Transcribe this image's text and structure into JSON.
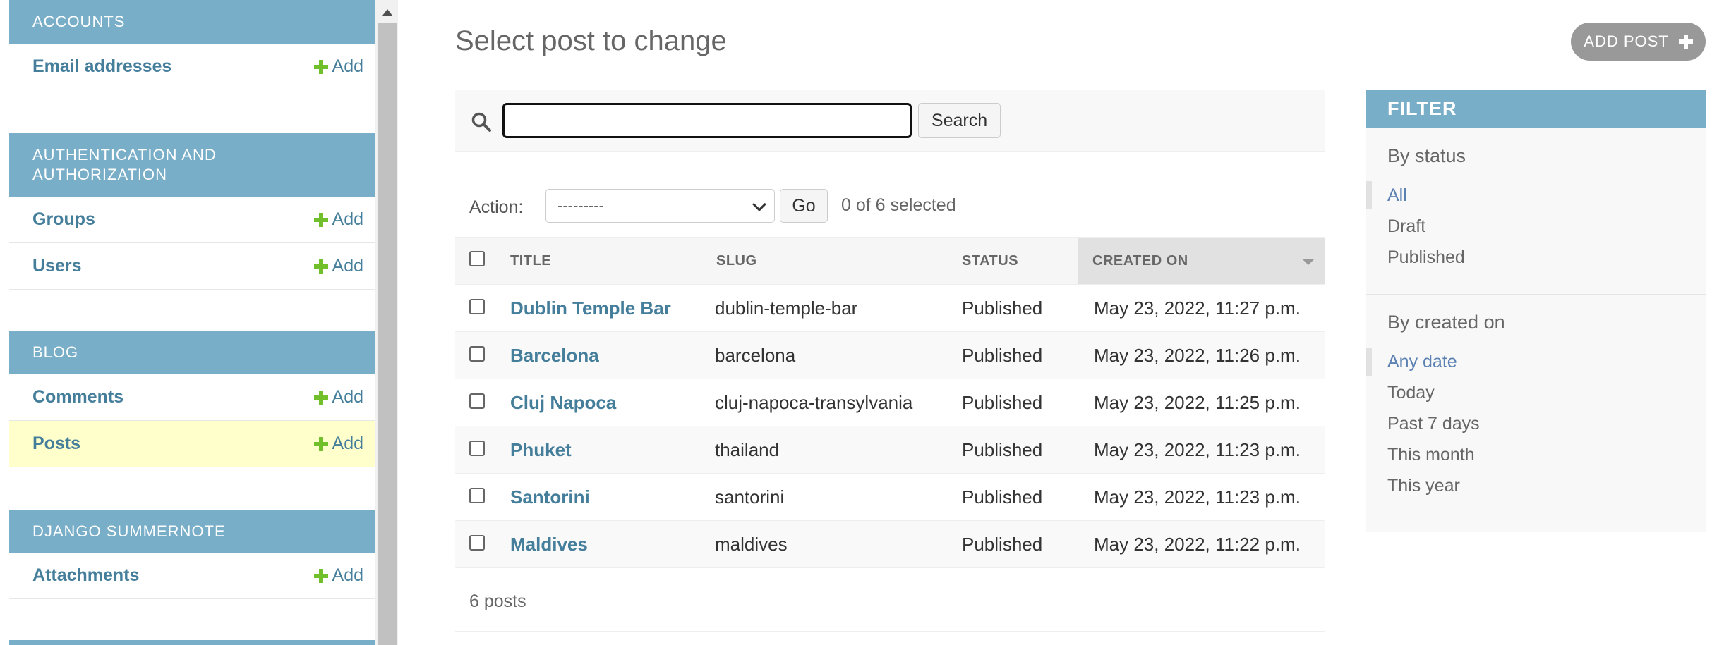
{
  "sidebar": {
    "modules": [
      {
        "caption": "ACCOUNTS",
        "rows": [
          {
            "label": "Email addresses",
            "add": "Add"
          }
        ]
      },
      {
        "caption": "AUTHENTICATION AND AUTHORIZATION",
        "rows": [
          {
            "label": "Groups",
            "add": "Add"
          },
          {
            "label": "Users",
            "add": "Add"
          }
        ]
      },
      {
        "caption": "BLOG",
        "rows": [
          {
            "label": "Comments",
            "add": "Add"
          },
          {
            "label": "Posts",
            "add": "Add",
            "current": true
          }
        ]
      },
      {
        "caption": "DJANGO SUMMERNOTE",
        "rows": [
          {
            "label": "Attachments",
            "add": "Add"
          }
        ]
      }
    ]
  },
  "header": {
    "title": "Select post to change",
    "add_button": "ADD POST"
  },
  "search": {
    "value": "",
    "button": "Search"
  },
  "actions": {
    "label": "Action:",
    "selected_option": "---------",
    "go": "Go",
    "selected_count": "0 of 6 selected"
  },
  "table": {
    "columns": [
      "TITLE",
      "SLUG",
      "STATUS",
      "CREATED ON"
    ],
    "rows": [
      {
        "title": "Dublin Temple Bar",
        "slug": "dublin-temple-bar",
        "status": "Published",
        "created": "May 23, 2022, 11:27 p.m."
      },
      {
        "title": "Barcelona",
        "slug": "barcelona",
        "status": "Published",
        "created": "May 23, 2022, 11:26 p.m."
      },
      {
        "title": "Cluj Napoca",
        "slug": "cluj-napoca-transylvania",
        "status": "Published",
        "created": "May 23, 2022, 11:25 p.m."
      },
      {
        "title": "Phuket",
        "slug": "thailand",
        "status": "Published",
        "created": "May 23, 2022, 11:23 p.m."
      },
      {
        "title": "Santorini",
        "slug": "santorini",
        "status": "Published",
        "created": "May 23, 2022, 11:23 p.m."
      },
      {
        "title": "Maldives",
        "slug": "maldives",
        "status": "Published",
        "created": "May 23, 2022, 11:22 p.m."
      }
    ]
  },
  "paginator": {
    "text": "6 posts"
  },
  "filter": {
    "title": "FILTER",
    "sections": [
      {
        "heading": "By status",
        "items": [
          "All",
          "Draft",
          "Published"
        ],
        "selected": 0
      },
      {
        "heading": "By created on",
        "items": [
          "Any date",
          "Today",
          "Past 7 days",
          "This month",
          "This year"
        ],
        "selected": 0
      }
    ]
  },
  "colors": {
    "accent": "#79aec8",
    "link": "#447e9b",
    "add_green": "#70bf2b",
    "current_row": "#ffffcc"
  }
}
